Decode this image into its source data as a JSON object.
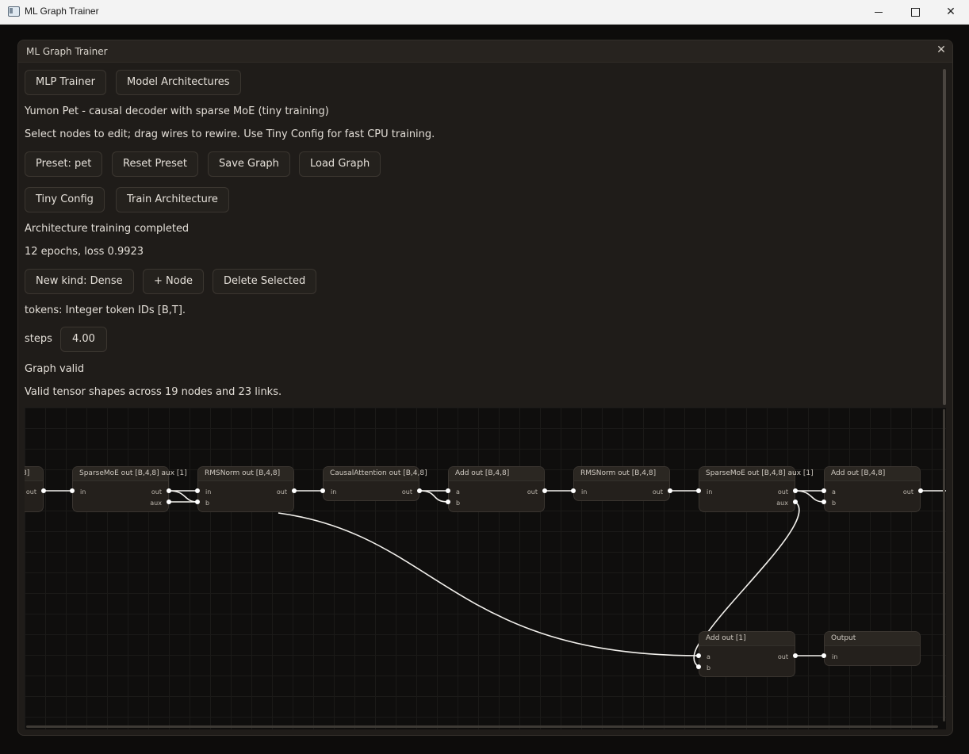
{
  "os": {
    "title": "ML Graph Trainer"
  },
  "panel": {
    "title": "ML Graph Trainer",
    "close": "✕"
  },
  "tabs": [
    "MLP Trainer",
    "Model Architectures"
  ],
  "heading": "Yumon Pet - causal decoder with sparse MoE (tiny training)",
  "hint": "Select nodes to edit; drag wires to rewire. Use Tiny Config for fast CPU training.",
  "preset_buttons": [
    "Preset: pet",
    "Reset Preset",
    "Save Graph",
    "Load Graph"
  ],
  "train_buttons": [
    "Tiny Config",
    "Train Architecture"
  ],
  "status": "Architecture training completed",
  "metrics": "12 epochs, loss 0.9923",
  "node_buttons": [
    "New kind: Dense",
    "+ Node",
    "Delete Selected"
  ],
  "tokens_info": "tokens: Integer token IDs [B,T].",
  "steps": {
    "label": "steps",
    "value": "4.00"
  },
  "validity": "Graph valid",
  "validity_detail": "Valid tensor shapes across 19 nodes and 23 links.",
  "graph": {
    "nodes": [
      {
        "title": "8]",
        "ports_in": [],
        "ports_out": [
          "out"
        ]
      },
      {
        "title": "SparseMoE out [B,4,8] aux [1]",
        "ports_in": [
          "in"
        ],
        "ports_out": [
          "out",
          "aux"
        ]
      },
      {
        "title": "RMSNorm out [B,4,8]",
        "ports_in": [
          "in",
          "b"
        ],
        "ports_out": [
          "out"
        ]
      },
      {
        "title": "CausalAttention out [B,4,8]",
        "ports_in": [
          "in"
        ],
        "ports_out": [
          "out"
        ]
      },
      {
        "title": "Add out [B,4,8]",
        "ports_in": [
          "a",
          "b"
        ],
        "ports_out": [
          "out"
        ]
      },
      {
        "title": "RMSNorm out [B,4,8]",
        "ports_in": [
          "in"
        ],
        "ports_out": [
          "out"
        ]
      },
      {
        "title": "SparseMoE out [B,4,8] aux [1]",
        "ports_in": [
          "in"
        ],
        "ports_out": [
          "out",
          "aux"
        ]
      },
      {
        "title": "Add out [B,4,8]",
        "ports_in": [
          "a",
          "b"
        ],
        "ports_out": [
          "out"
        ]
      },
      {
        "title": "Add out [1]",
        "ports_in": [
          "a",
          "b"
        ],
        "ports_out": [
          "out"
        ]
      },
      {
        "title": "Output",
        "ports_in": [
          "in"
        ],
        "ports_out": []
      }
    ]
  }
}
